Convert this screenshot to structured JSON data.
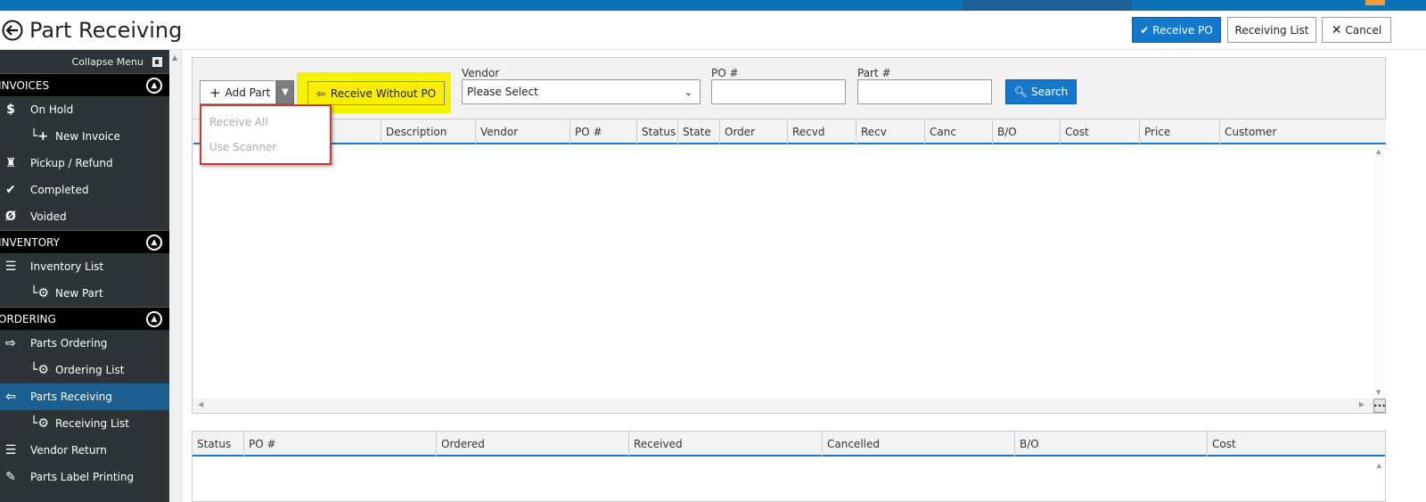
{
  "header": {
    "title": "Part Receiving",
    "buttons": {
      "receive_po": "Receive PO",
      "receiving_list": "Receiving List",
      "cancel": "Cancel"
    }
  },
  "sidebar": {
    "collapse_label": "Collapse Menu",
    "sections": [
      {
        "title": "INVOICES",
        "items": [
          {
            "label": "On Hold",
            "icon": "dollar-icon"
          },
          {
            "label": "New Invoice",
            "icon": "plus-icon",
            "sub": true
          },
          {
            "label": "Pickup / Refund",
            "icon": "pickup-icon"
          },
          {
            "label": "Completed",
            "icon": "check-icon"
          },
          {
            "label": "Voided",
            "icon": "void-icon"
          }
        ]
      },
      {
        "title": "INVENTORY",
        "items": [
          {
            "label": "Inventory List",
            "icon": "list-icon"
          },
          {
            "label": "New Part",
            "icon": "gear-icon",
            "sub": true
          }
        ]
      },
      {
        "title": "ORDERING",
        "items": [
          {
            "label": "Parts Ordering",
            "icon": "export-icon"
          },
          {
            "label": "Ordering List",
            "icon": "gear-icon",
            "sub": true
          },
          {
            "label": "Parts Receiving",
            "icon": "import-icon",
            "active": true
          },
          {
            "label": "Receiving List",
            "icon": "gear-icon",
            "sub": true
          },
          {
            "label": "Vendor Return",
            "icon": "list-icon"
          },
          {
            "label": "Parts Label Printing",
            "icon": "tag-icon"
          }
        ]
      }
    ]
  },
  "toolbar": {
    "add_part": "Add Part",
    "receive_without_po": "Receive Without PO",
    "vendor_label": "Vendor",
    "vendor_value": "Please Select",
    "po_label": "PO #",
    "part_label": "Part #",
    "search": "Search"
  },
  "dropdown": {
    "items": [
      "Receive All",
      "Use Scanner"
    ]
  },
  "grid": {
    "columns": [
      "Description",
      "Vendor",
      "PO #",
      "Status",
      "State",
      "Order",
      "Recvd",
      "Recv",
      "Canc",
      "B/O",
      "Cost",
      "Price",
      "Customer"
    ]
  },
  "lower_grid": {
    "columns": [
      "Status",
      "PO #",
      "Ordered",
      "Received",
      "Cancelled",
      "B/O",
      "Cost"
    ]
  },
  "colors": {
    "accent": "#1479cc",
    "sidebar_bg": "#2d3437",
    "highlight": "#f5f200",
    "annotation": "#d63131"
  }
}
